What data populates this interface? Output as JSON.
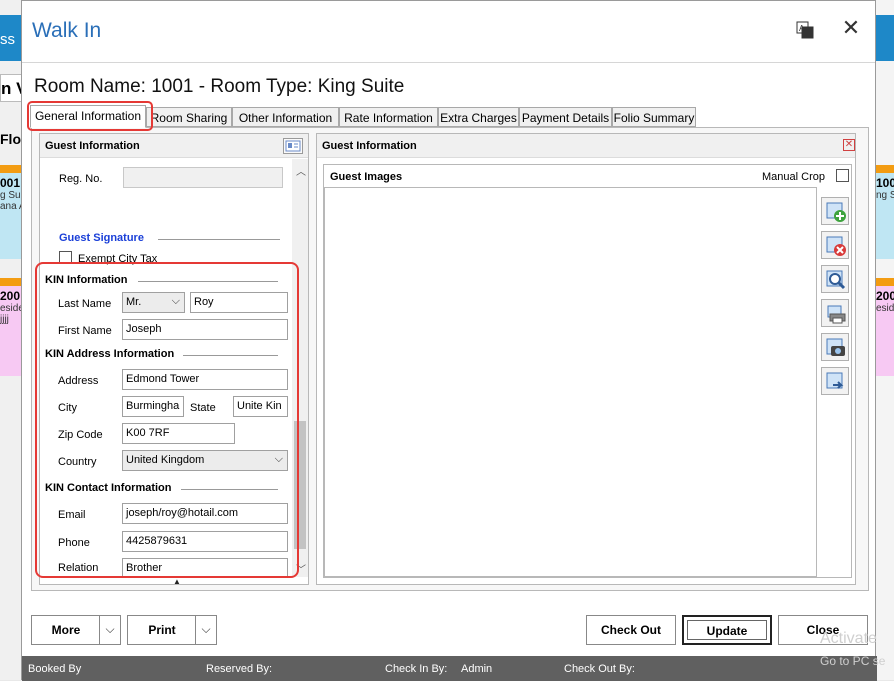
{
  "background": {
    "left_top_text": "ss",
    "left_row2_text": "n V",
    "left_row3_text": "Floo",
    "left_card1_title": "001",
    "left_card1_sub1": "g Su",
    "left_card1_sub2": "ana A",
    "left_card2_title": "200",
    "left_card2_sub1": "eside",
    "left_card2_sub2": "jjjj",
    "right_card1_title": "100",
    "right_card1_sub": "ng S",
    "right_card2_title": "200",
    "right_card2_sub": "eside"
  },
  "dialog": {
    "title": "Walk In",
    "room_heading": "Room Name: 1001 - Room Type: King Suite"
  },
  "tabs": [
    {
      "label": "General Information",
      "active": true
    },
    {
      "label": "Room Sharing"
    },
    {
      "label": "Other Information"
    },
    {
      "label": "Rate Information"
    },
    {
      "label": "Extra Charges"
    },
    {
      "label": "Payment Details"
    },
    {
      "label": "Folio Summary"
    }
  ],
  "left_panel": {
    "header": "Guest Information",
    "reg_no_label": "Reg. No.",
    "reg_no_value": "",
    "guest_signature_label": "Guest Signature",
    "exempt_city_tax_label": "Exempt City Tax",
    "kin_info_header": "KIN Information",
    "last_name_label": "Last Name",
    "salutation_value": "Mr.",
    "last_name_value": "Roy",
    "first_name_label": "First Name",
    "first_name_value": "Joseph",
    "kin_address_header": "KIN Address Information",
    "address_label": "Address",
    "address_value": "Edmond Tower",
    "city_label": "City",
    "city_value": "Burmingha",
    "state_label": "State",
    "state_value": "Unite Kin",
    "zip_label": "Zip Code",
    "zip_value": "K00 7RF",
    "country_label": "Country",
    "country_value": "United Kingdom",
    "kin_contact_header": "KIN Contact Information",
    "email_label": "Email",
    "email_value": "joseph/roy@hotail.com",
    "phone_label": "Phone",
    "phone_value": "4425879631",
    "relation_label": "Relation",
    "relation_value": "Brother"
  },
  "right_panel": {
    "header": "Guest Information",
    "images_header": "Guest Images",
    "manual_crop_label": "Manual Crop",
    "tools": [
      "add-image-icon",
      "delete-image-icon",
      "zoom-image-icon",
      "print-image-icon",
      "camera-icon",
      "export-image-icon"
    ]
  },
  "buttons": {
    "more": "More",
    "print": "Print",
    "check_out": "Check Out",
    "update": "Update",
    "close": "Close"
  },
  "status_bar": {
    "booked_by_label": "Booked By",
    "reserved_by_label": "Reserved By:",
    "check_in_by_label": "Check In By:",
    "check_in_by_value": "Admin",
    "check_out_by_label": "Check Out By:"
  },
  "watermark": {
    "line1": "Activate",
    "line2": "Go to PC se"
  },
  "colors": {
    "title_blue": "#2a6fb8",
    "signature_blue": "#1a3fd8",
    "highlight_red": "#e53935",
    "status_bar": "#606060",
    "bg_blue": "#1e88c8"
  }
}
